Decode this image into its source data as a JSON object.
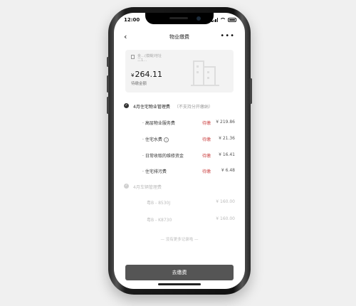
{
  "status": {
    "time": "12:00"
  },
  "nav": {
    "back": "‹",
    "title": "物业缴费",
    "more": "•••"
  },
  "card": {
    "address_line1": "金…(模糊)地址",
    "address_line2": "二1…",
    "currency": "¥",
    "amount": "264.11",
    "amount_label": "待缴金额"
  },
  "section1": {
    "title": "4月住宅物业管理费",
    "note": "（不支持分开缴纳）",
    "items": [
      {
        "name": "· 高层物业服务费",
        "status": "待缴",
        "amount": "¥ 219.86"
      },
      {
        "name": "· 住宅水费",
        "status": "待缴",
        "amount": "¥ 21.36"
      },
      {
        "name": "· 日常收取的维修资金",
        "status": "待缴",
        "amount": "¥ 16.41"
      },
      {
        "name": "· 住宅排污费",
        "status": "待缴",
        "amount": "¥ 6.48"
      }
    ]
  },
  "section2": {
    "title": "4月车辆管理费",
    "items": [
      {
        "name": "粤B - 8530J",
        "amount": "¥ 160.00"
      },
      {
        "name": "粤B - K8730",
        "amount": "¥ 160.00"
      }
    ]
  },
  "footer": {
    "end_text": "— 没有更多记录啦 —",
    "pay_button": "去缴费"
  },
  "colors": {
    "accent": "#555555",
    "pending": "#cc4444"
  }
}
